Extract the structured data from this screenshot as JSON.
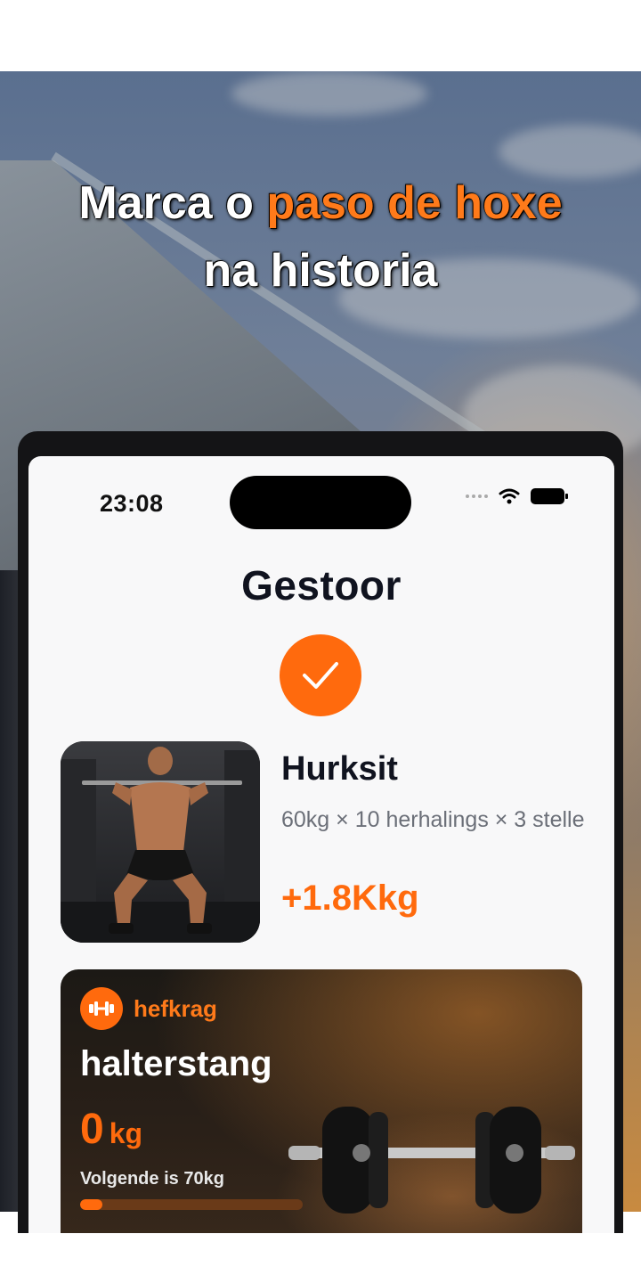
{
  "headline": {
    "prefix": "Marca o ",
    "accent": "paso de hoxe",
    "line2": "na historia"
  },
  "status_bar": {
    "time": "23:08"
  },
  "screen": {
    "title": "Gestoor",
    "exercise": {
      "name": "Hurksit",
      "detail": "60kg × 10 herhalings × 3 stelle",
      "gain": "+1.8Kkg"
    },
    "card": {
      "brand": "hefkrag",
      "title": "halterstang",
      "weight_value": "0",
      "weight_unit": "kg",
      "next_label": "Volgende is 70kg",
      "progress": 0.1
    }
  },
  "colors": {
    "accent": "#ff6a0d",
    "title": "#10131f",
    "muted": "#6b6f78"
  },
  "icons": [
    "check-icon",
    "dumbbell-icon",
    "wifi-icon",
    "battery-icon",
    "signal-icon"
  ]
}
